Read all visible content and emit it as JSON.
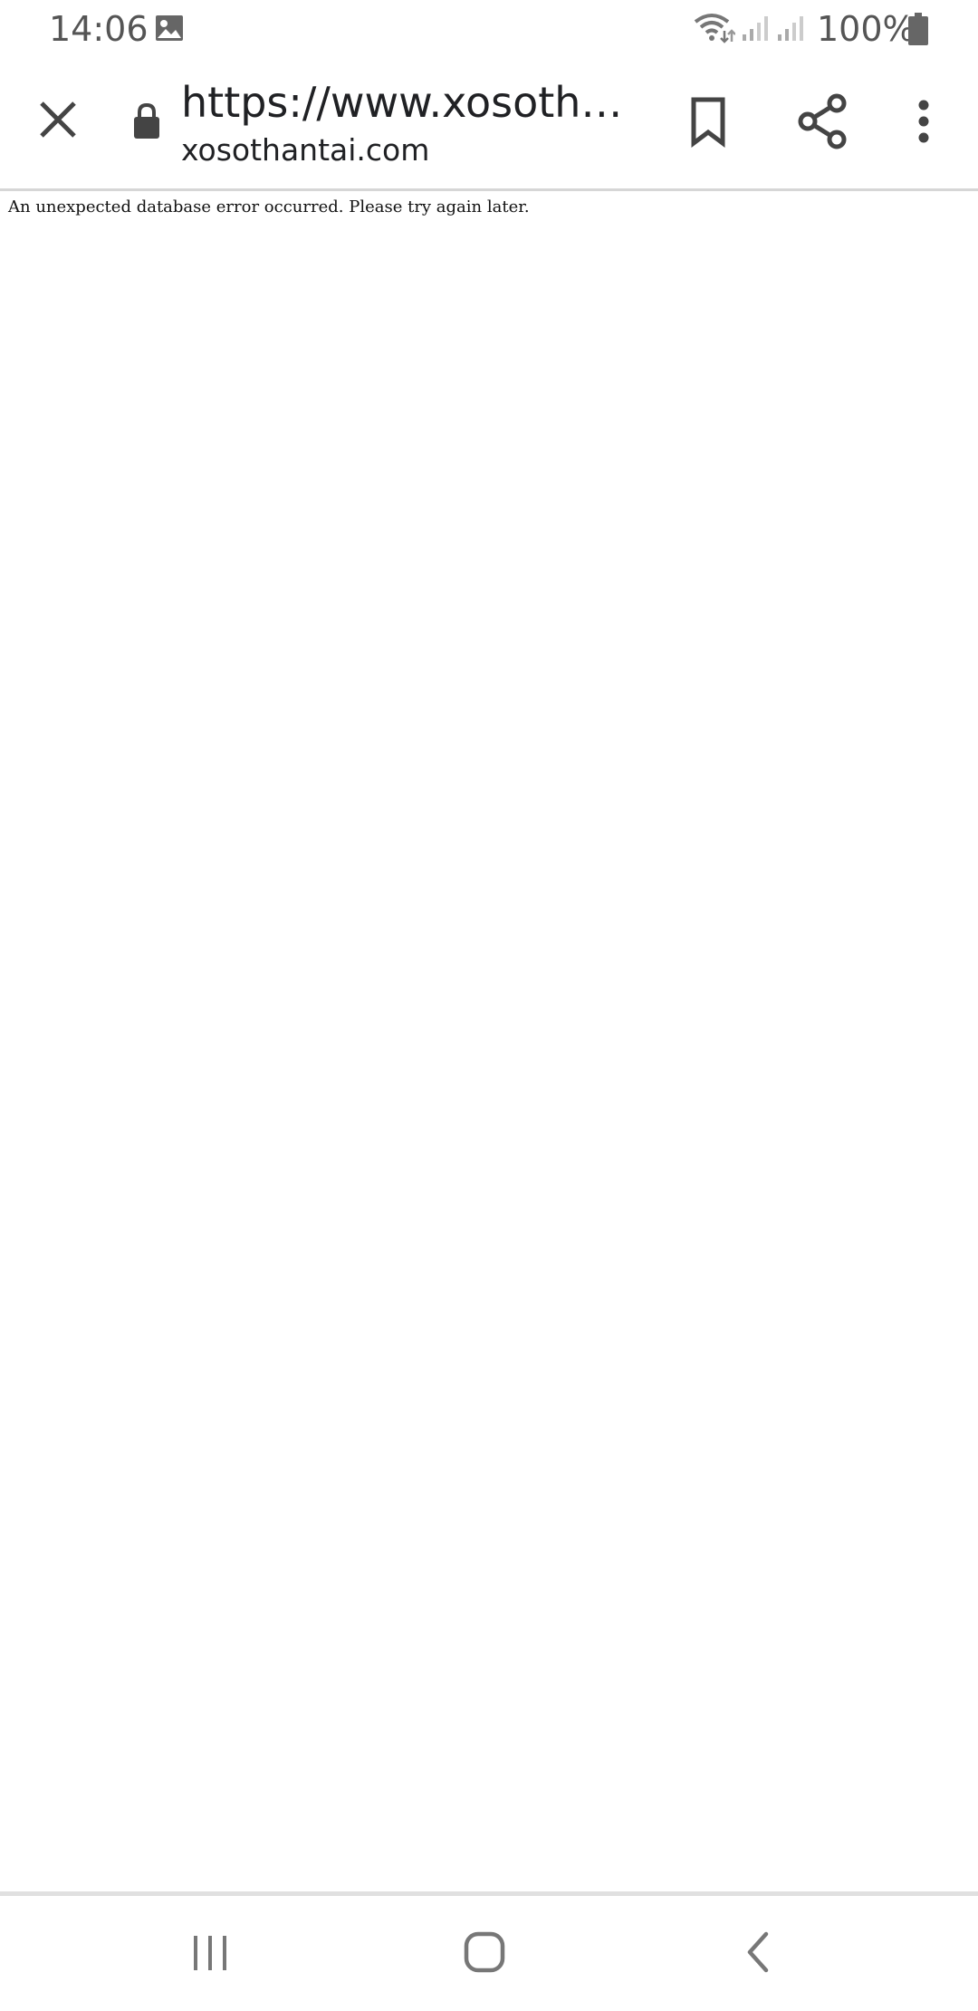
{
  "status_bar": {
    "time": "14:06",
    "battery": "100%",
    "icons": [
      "gallery-icon",
      "wifi-icon",
      "signal-icon",
      "signal-icon",
      "battery-icon"
    ]
  },
  "toolbar": {
    "url": "https://www.xosothan…",
    "domain": "xosothantai.com",
    "icons": [
      "close-icon",
      "lock-icon",
      "bookmark-icon",
      "share-icon",
      "more-vert-icon"
    ]
  },
  "page": {
    "error_message": "An unexpected database error occurred. Please try again later."
  },
  "nav_bar": {
    "icons": [
      "recents-icon",
      "home-icon",
      "back-icon"
    ]
  },
  "colors": {
    "icon": "#444444",
    "text": "#202124",
    "status_text": "#555555"
  }
}
